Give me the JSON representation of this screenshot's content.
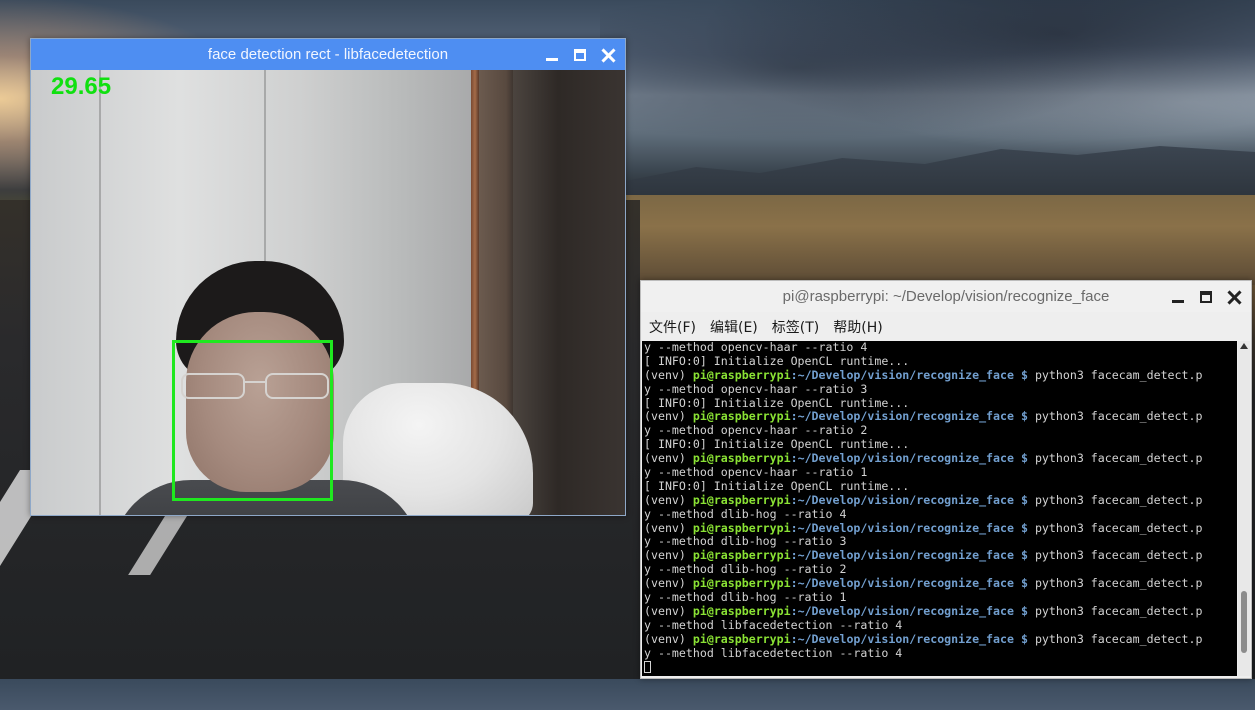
{
  "camera_window": {
    "title": "face detection rect - libfacedetection",
    "fps": "29.65"
  },
  "terminal_window": {
    "title": "pi@raspberrypi: ~/Develop/vision/recognize_face",
    "menu": [
      "文件(F)",
      "编辑(E)",
      "标签(T)",
      "帮助(H)"
    ],
    "lines": [
      {
        "type": "out",
        "text": "y --method opencv-haar --ratio 4"
      },
      {
        "type": "out",
        "text": "[ INFO:0] Initialize OpenCL runtime..."
      },
      {
        "type": "prompt",
        "venv": "(venv) ",
        "user": "pi@raspberrypi",
        "path": "~/Develop/vision/recognize_face",
        "sym": " $ ",
        "cmd": "python3 facecam_detect.p"
      },
      {
        "type": "out",
        "text": "y --method opencv-haar --ratio 3"
      },
      {
        "type": "out",
        "text": "[ INFO:0] Initialize OpenCL runtime..."
      },
      {
        "type": "prompt",
        "venv": "(venv) ",
        "user": "pi@raspberrypi",
        "path": "~/Develop/vision/recognize_face",
        "sym": " $ ",
        "cmd": "python3 facecam_detect.p"
      },
      {
        "type": "out",
        "text": "y --method opencv-haar --ratio 2"
      },
      {
        "type": "out",
        "text": "[ INFO:0] Initialize OpenCL runtime..."
      },
      {
        "type": "prompt",
        "venv": "(venv) ",
        "user": "pi@raspberrypi",
        "path": "~/Develop/vision/recognize_face",
        "sym": " $ ",
        "cmd": "python3 facecam_detect.p"
      },
      {
        "type": "out",
        "text": "y --method opencv-haar --ratio 1"
      },
      {
        "type": "out",
        "text": "[ INFO:0] Initialize OpenCL runtime..."
      },
      {
        "type": "prompt",
        "venv": "(venv) ",
        "user": "pi@raspberrypi",
        "path": "~/Develop/vision/recognize_face",
        "sym": " $ ",
        "cmd": "python3 facecam_detect.p"
      },
      {
        "type": "out",
        "text": "y --method dlib-hog --ratio 4"
      },
      {
        "type": "prompt",
        "venv": "(venv) ",
        "user": "pi@raspberrypi",
        "path": "~/Develop/vision/recognize_face",
        "sym": " $ ",
        "cmd": "python3 facecam_detect.p"
      },
      {
        "type": "out",
        "text": "y --method dlib-hog --ratio 3"
      },
      {
        "type": "prompt",
        "venv": "(venv) ",
        "user": "pi@raspberrypi",
        "path": "~/Develop/vision/recognize_face",
        "sym": " $ ",
        "cmd": "python3 facecam_detect.p"
      },
      {
        "type": "out",
        "text": "y --method dlib-hog --ratio 2"
      },
      {
        "type": "prompt",
        "venv": "(venv) ",
        "user": "pi@raspberrypi",
        "path": "~/Develop/vision/recognize_face",
        "sym": " $ ",
        "cmd": "python3 facecam_detect.p"
      },
      {
        "type": "out",
        "text": "y --method dlib-hog --ratio 1"
      },
      {
        "type": "prompt",
        "venv": "(venv) ",
        "user": "pi@raspberrypi",
        "path": "~/Develop/vision/recognize_face",
        "sym": " $ ",
        "cmd": "python3 facecam_detect.p"
      },
      {
        "type": "out",
        "text": "y --method libfacedetection --ratio 4"
      },
      {
        "type": "prompt",
        "venv": "(venv) ",
        "user": "pi@raspberrypi",
        "path": "~/Develop/vision/recognize_face",
        "sym": " $ ",
        "cmd": "python3 facecam_detect.p"
      },
      {
        "type": "out",
        "text": "y --method libfacedetection --ratio 4"
      },
      {
        "type": "cursor"
      }
    ]
  },
  "colors": {
    "title_blue": "#4e8ef2",
    "face_rect": "#1fe81f",
    "prompt_green": "#8ae234",
    "prompt_blue": "#729fcf"
  }
}
